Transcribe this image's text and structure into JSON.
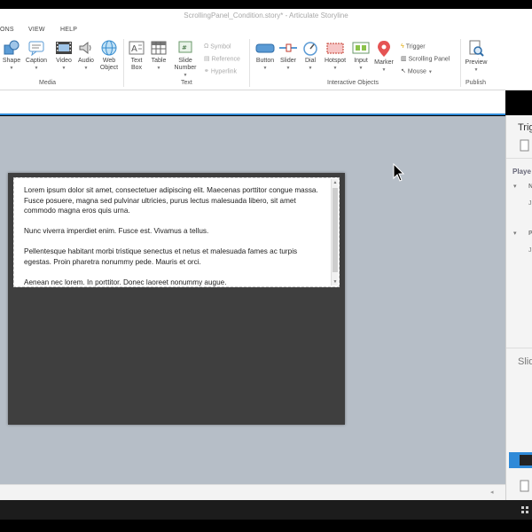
{
  "window": {
    "title": "ScrollingPanel_Condition.story* - Articulate Storyline"
  },
  "menu": {
    "items": [
      "ONS",
      "VIEW",
      "HELP"
    ]
  },
  "ribbon": {
    "media": {
      "group_label": "Media",
      "buttons": [
        "Shape",
        "Caption",
        "Video",
        "Audio",
        "Web Object"
      ]
    },
    "text": {
      "group_label": "Text",
      "buttons": [
        "Text Box",
        "Table",
        "Slide Number"
      ],
      "mini": [
        "Symbol",
        "Reference",
        "Hyperlink"
      ]
    },
    "interactive": {
      "group_label": "Interactive Objects",
      "buttons": [
        "Button",
        "Slider",
        "Dial",
        "Hotspot",
        "Input",
        "Marker"
      ],
      "mini": [
        "Trigger",
        "Scrolling Panel",
        "Mouse"
      ]
    },
    "publish": {
      "group_label": "Publish",
      "buttons": [
        "Preview"
      ]
    }
  },
  "scrolling_panel": {
    "paragraphs": [
      "Lorem ipsum dolor sit amet, consectetuer adipiscing elit. Maecenas porttitor congue massa. Fusce posuere, magna sed pulvinar ultricies, purus lectus malesuada libero, sit amet commodo magna eros quis urna.",
      "Nunc viverra imperdiet enim. Fusce est. Vivamus a tellus.",
      "Pellentesque habitant morbi tristique senectus et netus et malesuada fames ac turpis egestas. Proin pharetra nonummy pede. Mauris et orci.",
      "Aenean nec lorem. In porttitor. Donec laoreet nonummy augue."
    ]
  },
  "right_panel": {
    "triggers_head": "Trig",
    "player_head": "Playe",
    "slide_head": "Slid",
    "rows": [
      "N",
      "Ju",
      "P",
      "Ju"
    ]
  },
  "colors": {
    "accent": "#2f8ad8",
    "canvas": "#b6bec7",
    "slide": "#3f3f3f"
  }
}
